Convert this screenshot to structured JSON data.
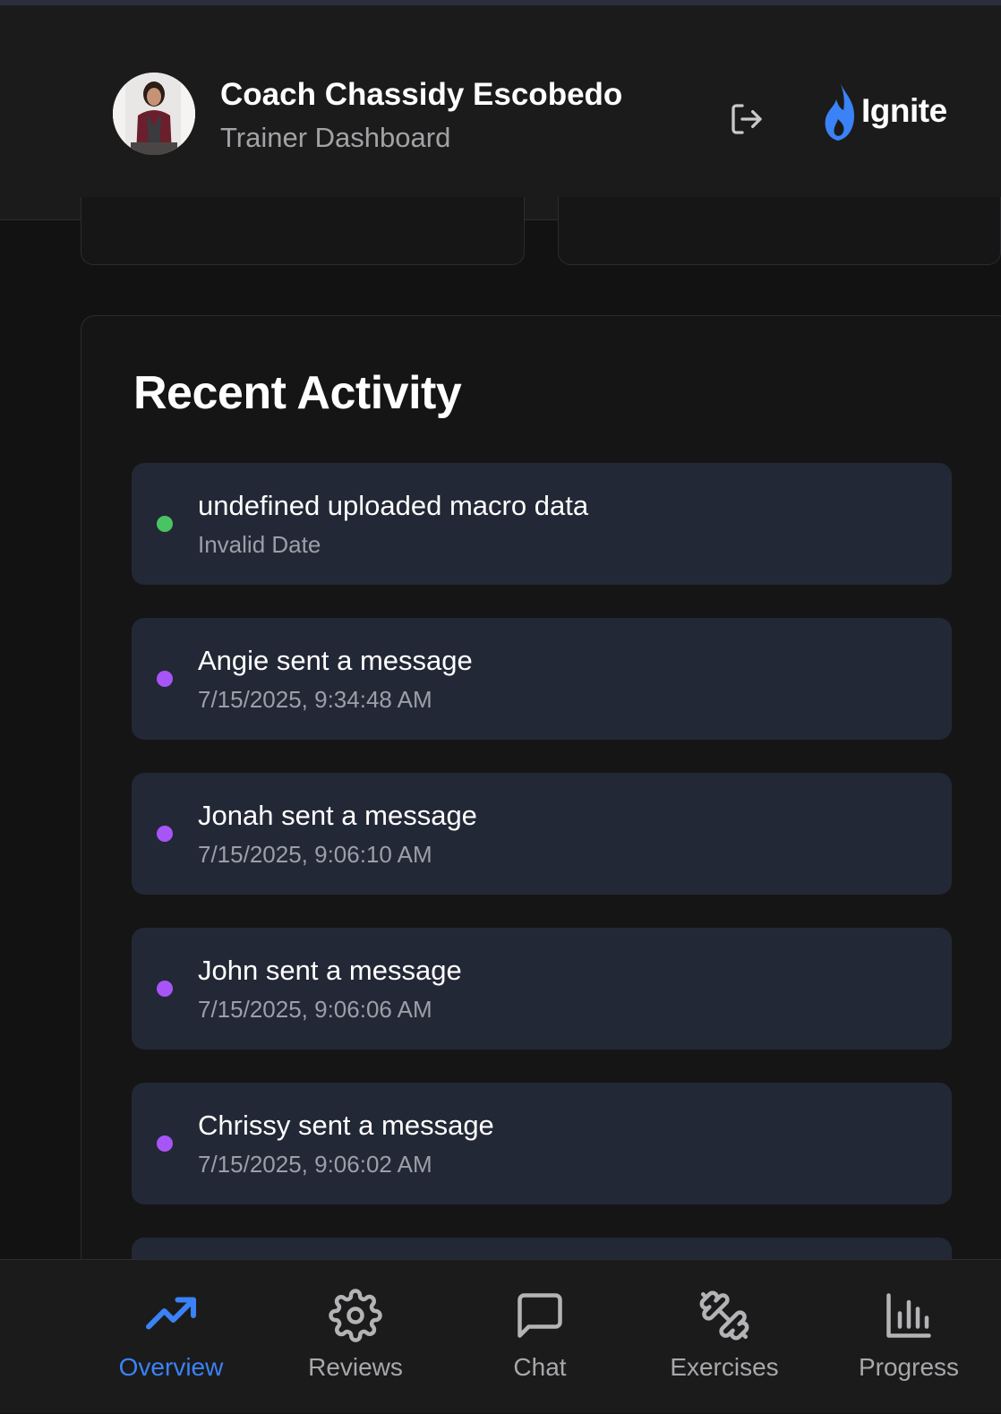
{
  "header": {
    "coach_name": "Coach Chassidy Escobedo",
    "role": "Trainer Dashboard",
    "brand": "Ignite"
  },
  "activity": {
    "title": "Recent Activity",
    "items": [
      {
        "text": "undefined uploaded macro data",
        "time": "Invalid Date",
        "dot_color": "#4ac463"
      },
      {
        "text": "Angie sent a message",
        "time": "7/15/2025, 9:34:48 AM",
        "dot_color": "#a855f7"
      },
      {
        "text": "Jonah sent a message",
        "time": "7/15/2025, 9:06:10 AM",
        "dot_color": "#a855f7"
      },
      {
        "text": "John sent a message",
        "time": "7/15/2025, 9:06:06 AM",
        "dot_color": "#a855f7"
      },
      {
        "text": "Chrissy sent a message",
        "time": "7/15/2025, 9:06:02 AM",
        "dot_color": "#a855f7"
      }
    ]
  },
  "nav": {
    "items": [
      {
        "label": "Overview",
        "icon": "trending-up-icon",
        "active": true
      },
      {
        "label": "Reviews",
        "icon": "gear-icon",
        "active": false
      },
      {
        "label": "Chat",
        "icon": "chat-bubble-icon",
        "active": false
      },
      {
        "label": "Exercises",
        "icon": "dumbbell-icon",
        "active": false
      },
      {
        "label": "Progress",
        "icon": "bar-chart-icon",
        "active": false
      }
    ]
  },
  "colors": {
    "accent": "#3b82f6",
    "item_bg": "#232836"
  }
}
